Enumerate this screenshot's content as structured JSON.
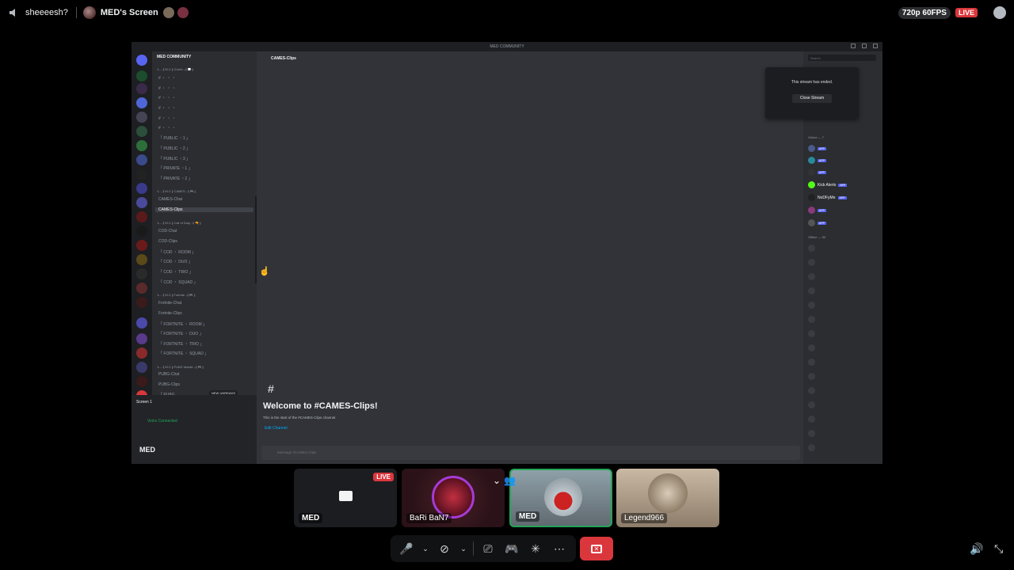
{
  "topbar": {
    "channel": "sheeeesh?",
    "streamer": "MED's Screen",
    "quality": "720p 60FPS",
    "live": "LIVE"
  },
  "screen": {
    "server": "MED COMMUNITY",
    "window_title": "MED COMMUNITY",
    "categories": [
      {
        "label": "↳ – ⟬ M.C ⟭ Chat's –⟬ 💬 ⟭"
      },
      {
        "label": "↳ – ⟬ M.C ⟭ CAMES –⟬ 🎮 ⟭"
      },
      {
        "label": "↳ – ⟬ M.C ⟭ Call of Duty –⟬ 🔫 ⟭"
      },
      {
        "label": "↳ – ⟬ M.C ⟭ Fortnite –⟬ 🎮 ⟭"
      },
      {
        "label": "↳ – ⟬ M.C ⟭ PUBG Mobile –⟬ 🎮 ⟭"
      }
    ],
    "channels_text": [
      "「 PUBLIC ・1 」",
      "「 PUBLIC ・2 」",
      "「 PUBLIC ・3 」",
      "「 PRIVATE ・1 」",
      "「 PRIVATE ・2 」"
    ],
    "game_channels": [
      "CAMES-Chat",
      "CAMES-Clips"
    ],
    "cod_channels": [
      "COD-Chat",
      "COD-Clips",
      "「 COD ・ ROOM 」",
      "「 COD ・ DUO 」",
      "「 COD ・ TRIO 」",
      "「 COD ・ SQUAD 」"
    ],
    "fortnite_channels": [
      "Fortnite-Chat",
      "Fortnite-Clips",
      "「 FORTNITE ・ ROOM 」",
      "「 FORTNITE ・ DUO 」",
      "「 FORTNITE ・ TRIO 」",
      "「 FORTNITE ・ SQUAD 」"
    ],
    "pubg_channels": [
      "PUBG-Chat",
      "PUBG-Clips",
      "「 PUBG"
    ],
    "new_unreads": "NEW UNREADS",
    "current_channel": "CAMES-Clips",
    "welcome": "Welcome to #CAMES-Clips!",
    "start_text": "This is the start of the #CAMES-Clips channel.",
    "edit_channel": "Edit Channel",
    "message_placeholder": "Message #CAMES-Clips",
    "stream_ended": "This stream has ended.",
    "close_stream": "Close Stream",
    "screen_label": "Screen 1",
    "voice_connected": "Voice Connected",
    "username": "MED",
    "search": "Search",
    "online_group": "Online — 7",
    "offline_group": "Offline — 50",
    "members": [
      "Kick Alerts",
      "NoDFyMe"
    ]
  },
  "tiles": [
    {
      "name": "MED",
      "live": "LIVE"
    },
    {
      "name": "BaRi BaN7"
    },
    {
      "name": "MED"
    },
    {
      "name": "Legend966"
    }
  ]
}
